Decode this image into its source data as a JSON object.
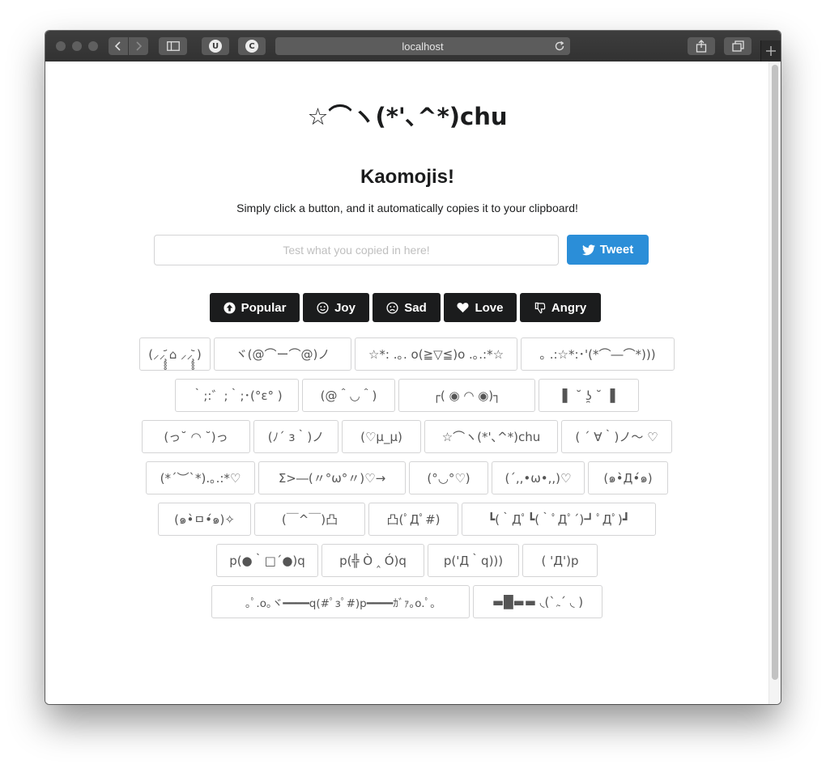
{
  "browser": {
    "address": "localhost"
  },
  "page": {
    "hero": "☆⌒ヽ(*'､^*)chu",
    "title": "Kaomojis!",
    "subtitle": "Simply click a button, and it automatically copies it to your clipboard!",
    "input_placeholder": "Test what you copied in here!",
    "tweet_label": "Tweet"
  },
  "categories": [
    "Popular",
    "Joy",
    "Sad",
    "Love",
    "Angry"
  ],
  "kaomojis": [
    [
      "(⸝⸝̧̥̥̥᷄ ⌂ ⸝⸝̧̥̥̥᷅ )",
      "ヾ(@⌒ー⌒@)ノ",
      "☆*: .｡. o(≧▽≦)o .｡.:*☆",
      "｡ .:☆*:･'(*⌒―⌒*)))"
    ],
    [
      "｀;:゛;｀;･(°ε° )",
      "(@＾◡＾)",
      "┌( ◉ ◠ ◉)┐",
      "▌ ˘ ʖ̯ ˘ ▐"
    ],
    [
      "(っ˘ ◠ ˘)っ",
      "(ﾉ´ з｀)ノ",
      "(♡μ_μ)",
      "☆⌒ヽ(*'､^*)chu",
      "( ´ ∀｀)ノ～ ♡"
    ],
    [
      "(*´︶`*).｡.:*♡",
      "Σ>―(〃°ω°〃)♡→",
      "(°◡°♡)",
      "(´,,•ω•,,)♡",
      "(๑•̀Д•́๑)"
    ],
    [
      "(๑•̀ㅁ•́๑)✧",
      "(￣^￣)凸",
      "凸(ﾟДﾟ#)",
      "┗(｀Дﾟ┗(｀ﾟДﾟ´)┛ﾟДﾟ)┛"
    ],
    [
      "p(●｀□´●)q",
      "p(╬ Ò ‸ Ó)q",
      "p('Д｀q)))",
      "( 'Д')p"
    ],
    [
      "｡ﾟ.o｡ヾ━━━━q(#ﾟзﾟ#)p━━━━ｶﾞｧ｡o.ﾟ｡",
      "▬█▬▬ ◟(`ﮧ´ ◟ )"
    ]
  ]
}
